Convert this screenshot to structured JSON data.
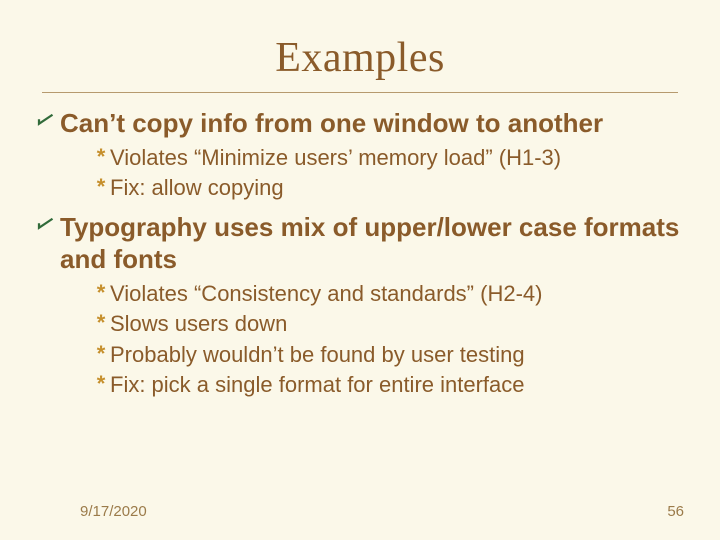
{
  "title": "Examples",
  "bullets": [
    {
      "text": "Can’t copy info from one window to another",
      "subs": [
        "Violates “Minimize users’ memory load” (H1-3)",
        "Fix: allow copying"
      ]
    },
    {
      "text": "Typography uses mix of upper/lower case formats and fonts",
      "subs": [
        "Violates “Consistency and standards” (H2-4)",
        "Slows users down",
        "Probably wouldn’t be found by user testing",
        "Fix: pick a single format for entire interface"
      ]
    }
  ],
  "footer": {
    "date": "9/17/2020",
    "page": "56"
  }
}
